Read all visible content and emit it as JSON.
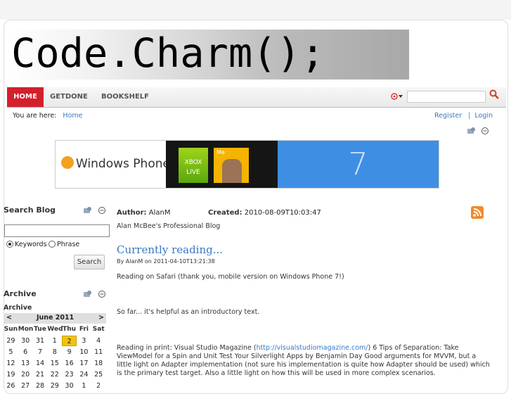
{
  "site": {
    "logo_text": "Code.Charm();"
  },
  "nav": {
    "items": [
      "HOME",
      "GETDONE",
      "BOOKSHELF"
    ],
    "accent": "#d3202d"
  },
  "breadcrumb": {
    "prefix": "You are here:",
    "link": "Home"
  },
  "account": {
    "register": "Register",
    "separator": "|",
    "login": "Login"
  },
  "banner": {
    "brand": "Windows Phone",
    "tile1_line1": "XBOX",
    "tile1_line2": "LIVE",
    "tile2_label": "Me",
    "version": "7"
  },
  "sidebar": {
    "search_title": "Search Blog",
    "options": [
      "Keywords",
      "Phrase"
    ],
    "search_button": "Search",
    "archive_title": "Archive",
    "archive_subtitle": "Archive",
    "calendar": {
      "prev": "<",
      "month": "June 2011",
      "next": ">",
      "days": [
        "Sun",
        "Mon",
        "Tue",
        "Wed",
        "Thu",
        "Fri",
        "Sat"
      ],
      "weeks": [
        [
          "29",
          "30",
          "31",
          "1",
          "2",
          "3",
          "4"
        ],
        [
          "5",
          "6",
          "7",
          "8",
          "9",
          "10",
          "11"
        ],
        [
          "12",
          "13",
          "14",
          "15",
          "16",
          "17",
          "18"
        ],
        [
          "19",
          "20",
          "21",
          "22",
          "23",
          "24",
          "25"
        ],
        [
          "26",
          "27",
          "28",
          "29",
          "30",
          "1",
          "2"
        ]
      ],
      "today": "2"
    }
  },
  "blog": {
    "author_label": "Author:",
    "author": "AlanM",
    "created_label": "Created:",
    "created": "2010-08-09T10:03:47",
    "description": "Alan McBee's Professional Blog"
  },
  "post": {
    "title": "Currently reading...",
    "byline": "By AlanM on 2011-04-10T13:21:38",
    "p1": "Reading on Safari (thank you, mobile version on Windows Phone 7!)",
    "p2": "So far... it's helpful as an introductory text.",
    "p3a": "Reading in print: Visual Studio Magazine (",
    "p3link": "http://visualstudiomagazine.com/",
    "p3b": ") 6 Tips of Separation: Take ViewModel for a Spin and Unit Test Your Silverlight Apps by Benjamin Day Good arguments for MVVM, but a little light on Adapter implementation (not sure his implementation is quite how Adapter should be used) which is the primary test target. Also a little light on how this will be used in more complex scenarios."
  }
}
